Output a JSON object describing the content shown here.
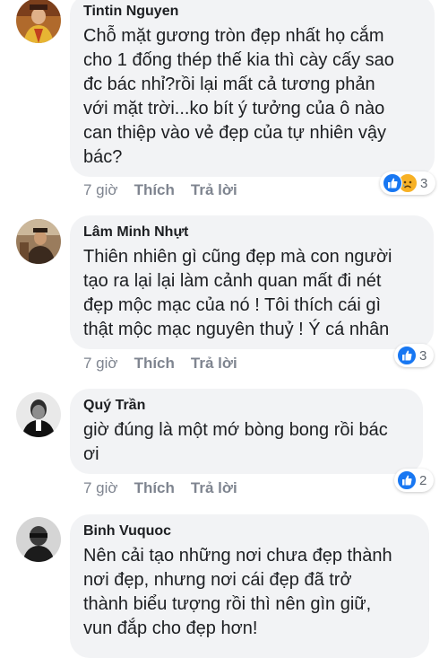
{
  "colors": {
    "bubble_bg": "#f2f3f5",
    "meta_text": "#7f8590",
    "like_blue": "#1877f2",
    "sad_yellow": "#f7b125"
  },
  "comments": [
    {
      "author": "Tintin Nguyen",
      "text": "Chỗ mặt gương tròn đẹp nhất họ cắm\ncho 1 đống thép thế kia thì cày cấy sao\nđc bác nhỉ?rồi lại mất cả tương phản\nvới mặt trời...ko bít ý tưởng của ô nào\ncan thiệp vào vẻ đẹp của tự nhiên vậy\nbác?",
      "time": "7 giờ",
      "like_label": "Thích",
      "reply_label": "Trả lời",
      "reaction_icons": [
        "like-icon",
        "sad-icon"
      ],
      "reaction_count": "3"
    },
    {
      "author": "Lâm Minh Nhựt",
      "text": "Thiên nhiên gì cũng đẹp mà con người\ntạo ra lại lại làm cảnh quan mất đi nét\nđẹp mộc mạc của nó ! Tôi thích cái gì\nthật mộc mạc nguyên thuỷ ! Ý cá nhân",
      "time": "7 giờ",
      "like_label": "Thích",
      "reply_label": "Trả lời",
      "reaction_icons": [
        "like-icon"
      ],
      "reaction_count": "3"
    },
    {
      "author": "Quý Trần",
      "text": "giờ đúng là một mớ bòng bong rồi bác\nơi",
      "time": "7 giờ",
      "like_label": "Thích",
      "reply_label": "Trả lời",
      "reaction_icons": [
        "like-icon"
      ],
      "reaction_count": "2"
    },
    {
      "author": "Binh Vuquoc",
      "text": "Nên cải tạo những nơi chưa đẹp thành\nnơi đẹp, nhưng nơi cái đẹp đã trở\nthành biểu tượng rồi thì nên gìn giữ,\nvun đắp cho đẹp hơn!",
      "reaction_icons": []
    }
  ]
}
